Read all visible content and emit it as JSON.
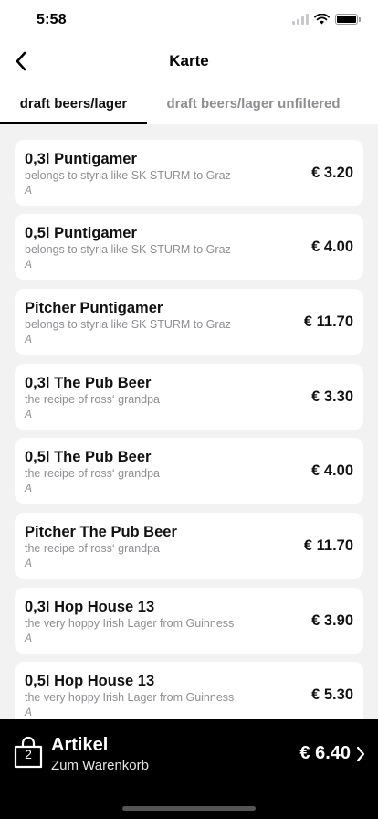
{
  "status_bar": {
    "time": "5:58"
  },
  "nav": {
    "title": "Karte",
    "back_icon": "chevron-left-icon"
  },
  "tabs": [
    {
      "label": "draft beers/lager",
      "active": true
    },
    {
      "label": "draft beers/lager unfiltered",
      "active": false
    }
  ],
  "menu_items": [
    {
      "name": "0,3l Puntigamer",
      "description": "belongs to styria like SK STURM to Graz",
      "tag": "A",
      "price": "€ 3.20"
    },
    {
      "name": "0,5l Puntigamer",
      "description": "belongs to styria like SK STURM to Graz",
      "tag": "A",
      "price": "€ 4.00"
    },
    {
      "name": "Pitcher Puntigamer",
      "description": "belongs to styria like SK STURM to Graz",
      "tag": "A",
      "price": "€ 11.70"
    },
    {
      "name": "0,3l The Pub Beer",
      "description": "the recipe of ross‘ grandpa",
      "tag": "A",
      "price": "€ 3.30"
    },
    {
      "name": "0,5l The Pub Beer",
      "description": "the recipe of ross‘ grandpa",
      "tag": "A",
      "price": "€ 4.00"
    },
    {
      "name": "Pitcher The Pub Beer",
      "description": "the recipe of ross‘ grandpa",
      "tag": "A",
      "price": "€ 11.70"
    },
    {
      "name": "0,3l Hop House 13",
      "description": "the very hoppy Irish Lager from Guinness",
      "tag": "A",
      "price": "€ 3.90"
    },
    {
      "name": "0,5l Hop House 13",
      "description": "the very hoppy Irish Lager from Guinness",
      "tag": "A",
      "price": "€ 5.30"
    }
  ],
  "cart": {
    "count": "2",
    "title": "Artikel",
    "subtitle": "Zum Warenkorb",
    "total": "€ 6.40",
    "bag_icon": "shopping-bag-icon",
    "chevron_icon": "chevron-right-icon"
  },
  "colors": {
    "background": "#f2f2f2",
    "card": "#ffffff",
    "cart_bar": "#000000",
    "muted_text": "#8e8e93"
  }
}
